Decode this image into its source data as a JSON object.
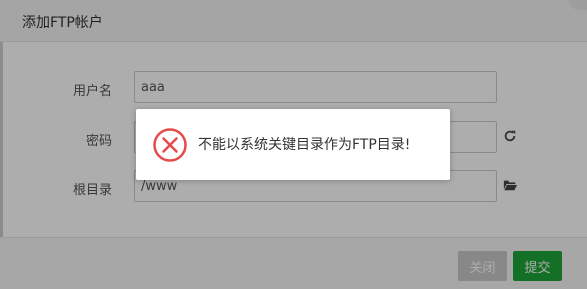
{
  "dialog": {
    "title": "添加FTP帐户"
  },
  "form": {
    "username": {
      "label": "用户名",
      "value": "aaa"
    },
    "password": {
      "label": "密码",
      "value": ""
    },
    "rootdir": {
      "label": "根目录",
      "value": "/www"
    }
  },
  "footer": {
    "close_label": "关闭",
    "submit_label": "提交"
  },
  "alert": {
    "message": "不能以系统关键目录作为FTP目录!",
    "icon": "error-circle-icon"
  },
  "colors": {
    "accent_green": "#20a53a",
    "error_red": "#e64b4b",
    "disabled_gray": "#c9c9c9"
  }
}
